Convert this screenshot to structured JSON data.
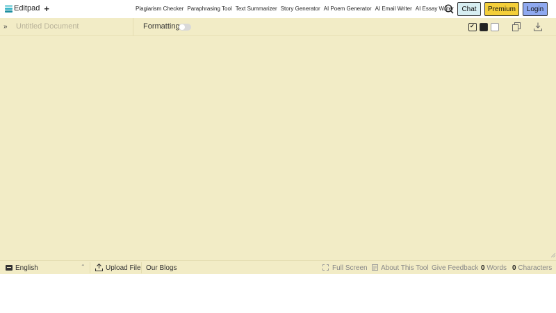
{
  "header": {
    "logo_text": "Editpad",
    "logo_plus": "+",
    "nav": [
      {
        "label": "Plagiarism Checker"
      },
      {
        "label": "Paraphrasing Tool"
      },
      {
        "label": "Text Summarizer"
      },
      {
        "label": "Story Generator"
      },
      {
        "label": "AI Poem Generator"
      },
      {
        "label": "AI Email Writer"
      },
      {
        "label": "AI Essay Writer"
      }
    ],
    "chat_label": "Chat",
    "premium_label": "Premium",
    "login_label": "Login"
  },
  "editor": {
    "title_placeholder": "Untitled Document",
    "formatting_label": "Formatting",
    "formatting_enabled": false,
    "theme_selected": "light",
    "background_color": "#f2ecc6"
  },
  "footer": {
    "language": "English",
    "upload_label": "Upload File",
    "blogs_label": "Our Blogs",
    "fullscreen_label": "Full Screen",
    "about_label": "About This Tool",
    "feedback_label": "Give Feedback",
    "word_count": "0",
    "word_label": "Words",
    "char_count": "0",
    "char_label": "Characters"
  },
  "colors": {
    "chat_button": "#d7eef2",
    "premium_button": "#f4cf3a",
    "login_button": "#8fa9f0"
  }
}
